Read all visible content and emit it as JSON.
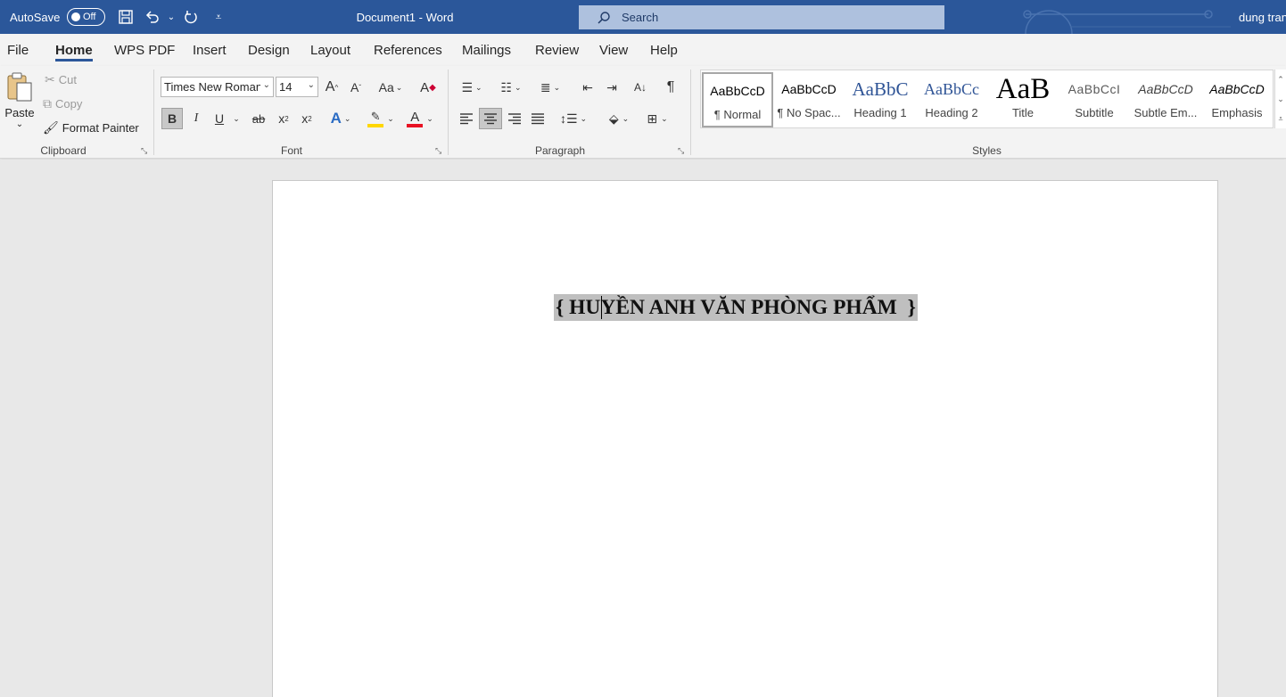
{
  "titlebar": {
    "autosave_label": "AutoSave",
    "autosave_state": "Off",
    "document_title": "Document1  -  Word",
    "search_placeholder": "Search",
    "user_name": "dung tran"
  },
  "tabs": [
    "File",
    "Home",
    "WPS PDF",
    "Insert",
    "Design",
    "Layout",
    "References",
    "Mailings",
    "Review",
    "View",
    "Help"
  ],
  "active_tab": "Home",
  "ribbon": {
    "clipboard": {
      "paste": "Paste",
      "cut": "Cut",
      "copy": "Copy",
      "format_painter": "Format Painter",
      "label": "Clipboard"
    },
    "font": {
      "font_name": "Times New Roman",
      "font_size": "14",
      "change_case": "Aa",
      "label": "Font"
    },
    "paragraph": {
      "label": "Paragraph"
    },
    "styles": {
      "label": "Styles",
      "items": [
        {
          "sample": "AaBbCcD",
          "name": "¶ Normal"
        },
        {
          "sample": "AaBbCcD",
          "name": "¶ No Spac..."
        },
        {
          "sample": "AaBbC",
          "name": "Heading 1"
        },
        {
          "sample": "AaBbCc",
          "name": "Heading 2"
        },
        {
          "sample": "AaB",
          "name": "Title"
        },
        {
          "sample": "AaBbCcI",
          "name": "Subtitle"
        },
        {
          "sample": "AaBbCcD",
          "name": "Subtle Em..."
        },
        {
          "sample": "AaBbCcD",
          "name": "Emphasis"
        }
      ]
    }
  },
  "document": {
    "text": "{ HUYỀN ANH VĂN PHÒNG PHẨM  }"
  },
  "colors": {
    "titlebar": "#2b579a",
    "ribbon_bg": "#f3f3f3",
    "highlight": "#bfbfbf",
    "font_color_bar": "#e81123",
    "highlight_color_bar": "#ffd700"
  }
}
